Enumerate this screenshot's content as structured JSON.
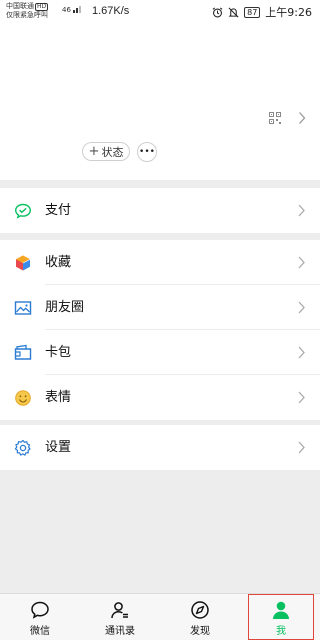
{
  "status_bar": {
    "carrier_line1": "中国联通",
    "hd_badge": "HD",
    "carrier_line2": "仅限紧急呼叫",
    "signal_text": "46",
    "net_speed": "1.67K/s",
    "battery": "87",
    "time": "上午9:26"
  },
  "profile": {
    "status_label": "状态",
    "status_plus": "+",
    "more_label": "•••"
  },
  "menu": {
    "pay": "支付",
    "favorites": "收藏",
    "moments": "朋友圈",
    "cards": "卡包",
    "stickers": "表情",
    "settings": "设置"
  },
  "tabs": [
    {
      "label": "微信"
    },
    {
      "label": "通讯录"
    },
    {
      "label": "发现"
    },
    {
      "label": "我"
    }
  ],
  "colors": {
    "accent": "#07c160",
    "active_outline": "#e0463a",
    "background": "#ededed"
  },
  "icons": {
    "pay": "wechat-pay-icon",
    "favorites": "cube-icon",
    "moments": "picture-icon",
    "cards": "wallet-card-icon",
    "stickers": "smile-icon",
    "settings": "gear-icon"
  }
}
